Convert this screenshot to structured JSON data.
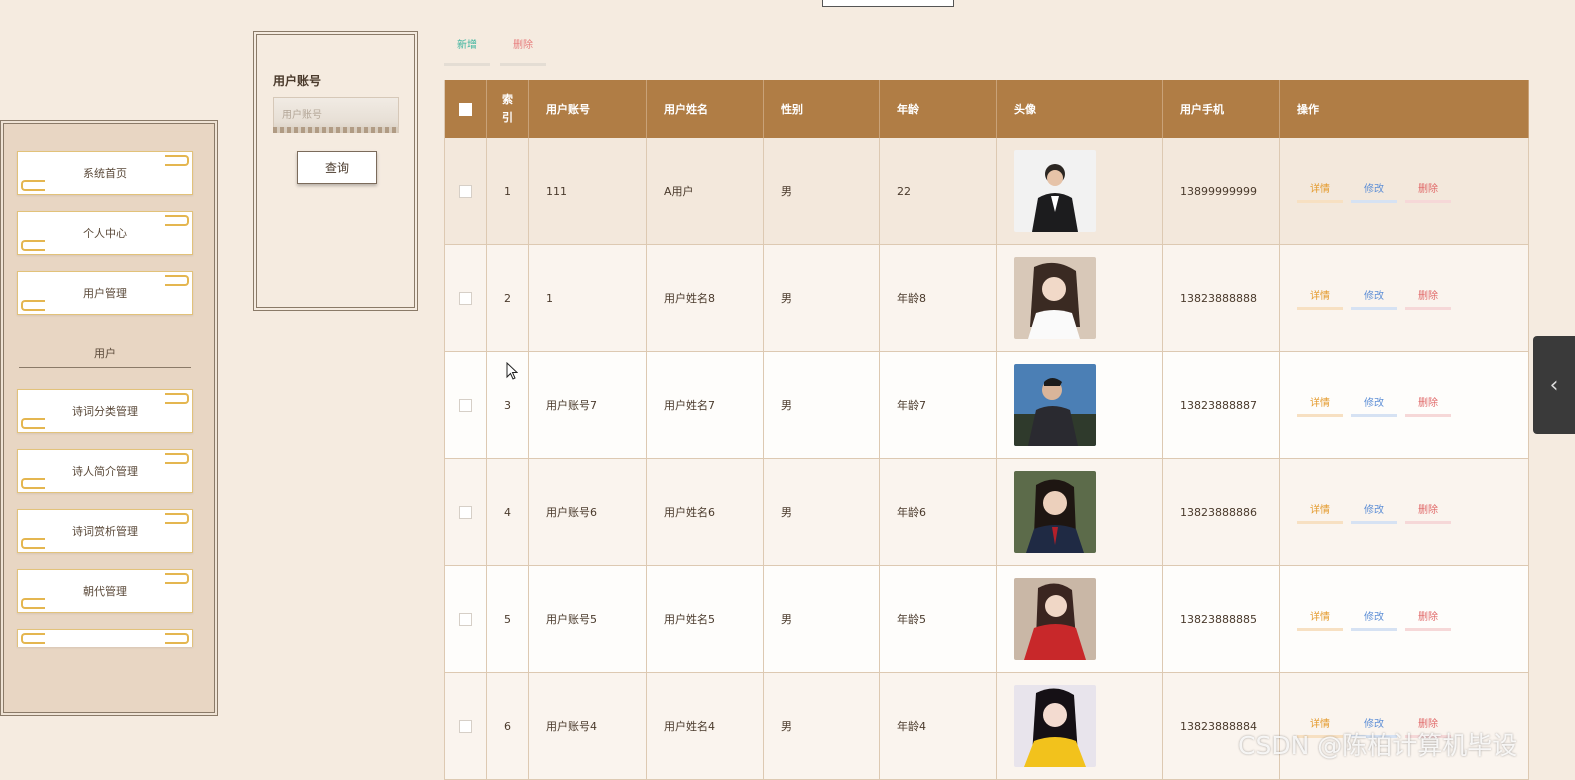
{
  "sidebar": {
    "items": [
      {
        "label": "系统首页"
      },
      {
        "label": "个人中心"
      },
      {
        "label": "用户管理"
      },
      {
        "label": "诗词分类管理"
      },
      {
        "label": "诗人简介管理"
      },
      {
        "label": "诗词赏析管理"
      },
      {
        "label": "朝代管理"
      }
    ],
    "group_label": "用户"
  },
  "search": {
    "label": "用户账号",
    "placeholder": "用户账号",
    "button": "查询"
  },
  "actions": {
    "add": "新增",
    "delete": "删除"
  },
  "table": {
    "columns": [
      "",
      "索引",
      "用户账号",
      "用户姓名",
      "性别",
      "年龄",
      "头像",
      "用户手机",
      "操作"
    ],
    "index_header_line1": "索",
    "index_header_line2": "引",
    "rows": [
      {
        "index": "1",
        "account": "111",
        "name": "A用户",
        "gender": "男",
        "age": "22",
        "phone": "13899999999"
      },
      {
        "index": "2",
        "account": "1",
        "name": "用户姓名8",
        "gender": "男",
        "age": "年龄8",
        "phone": "13823888888"
      },
      {
        "index": "3",
        "account": "用户账号7",
        "name": "用户姓名7",
        "gender": "男",
        "age": "年龄7",
        "phone": "13823888887"
      },
      {
        "index": "4",
        "account": "用户账号6",
        "name": "用户姓名6",
        "gender": "男",
        "age": "年龄6",
        "phone": "13823888886"
      },
      {
        "index": "5",
        "account": "用户账号5",
        "name": "用户姓名5",
        "gender": "男",
        "age": "年龄5",
        "phone": "13823888885"
      },
      {
        "index": "6",
        "account": "用户账号4",
        "name": "用户姓名4",
        "gender": "男",
        "age": "年龄4",
        "phone": "13823888884"
      }
    ],
    "ops": {
      "detail": "详情",
      "edit": "修改",
      "remove": "删除"
    }
  },
  "watermark": "CSDN @陈柏计算机毕设"
}
